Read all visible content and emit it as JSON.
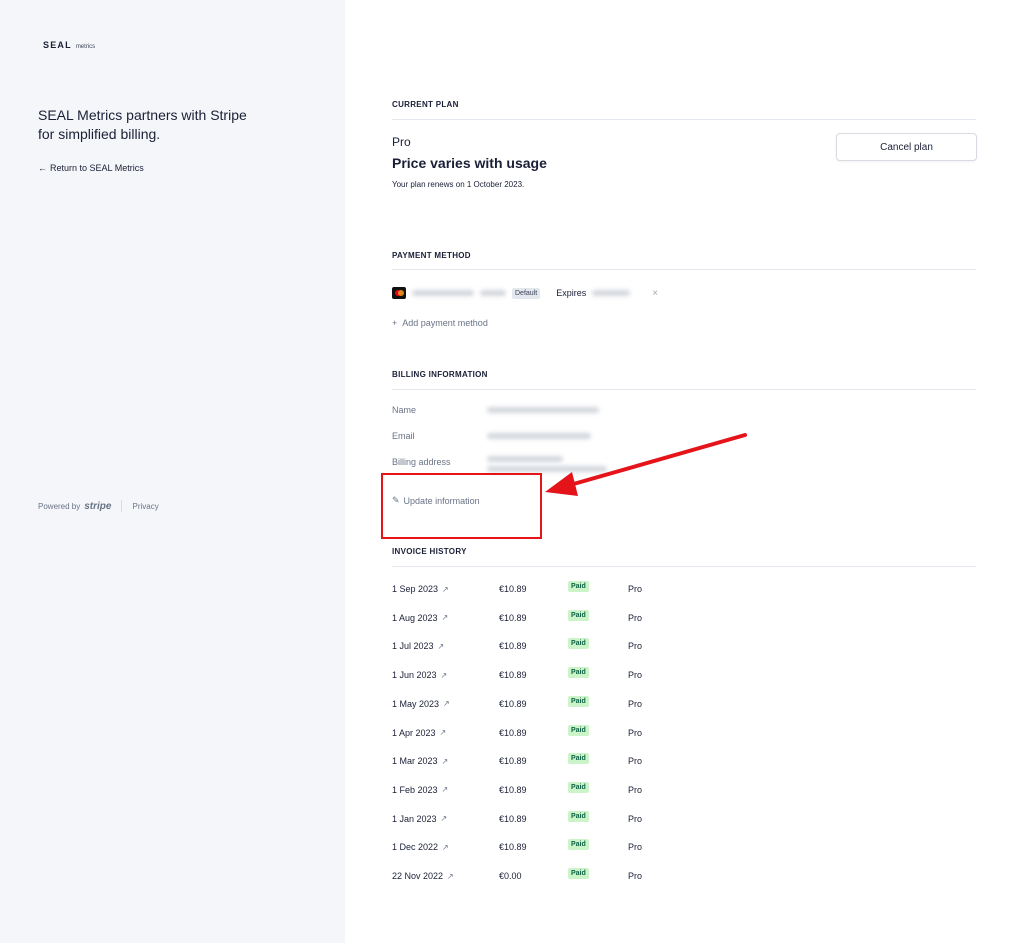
{
  "brand": {
    "logo_main": "SEAL",
    "logo_sub": "metrics"
  },
  "left": {
    "headline": "SEAL Metrics partners with Stripe for simplified billing.",
    "return_link": "Return to SEAL Metrics",
    "powered_by": "Powered by",
    "stripe": "stripe",
    "privacy": "Privacy"
  },
  "current_plan": {
    "section_title": "CURRENT PLAN",
    "name": "Pro",
    "price": "Price varies with usage",
    "renews": "Your plan renews on 1 October 2023.",
    "cancel_label": "Cancel plan"
  },
  "payment_method": {
    "section_title": "PAYMENT METHOD",
    "default_badge": "Default",
    "expires_label": "Expires",
    "remove_icon": "×",
    "add_label": "Add payment method"
  },
  "billing_info": {
    "section_title": "BILLING INFORMATION",
    "name_label": "Name",
    "email_label": "Email",
    "address_label": "Billing address",
    "update_label": "Update information"
  },
  "invoice_history": {
    "section_title": "INVOICE HISTORY",
    "rows": [
      {
        "date": "1 Sep 2023",
        "amount": "€10.89",
        "status": "Paid",
        "plan": "Pro"
      },
      {
        "date": "1 Aug 2023",
        "amount": "€10.89",
        "status": "Paid",
        "plan": "Pro"
      },
      {
        "date": "1 Jul 2023",
        "amount": "€10.89",
        "status": "Paid",
        "plan": "Pro"
      },
      {
        "date": "1 Jun 2023",
        "amount": "€10.89",
        "status": "Paid",
        "plan": "Pro"
      },
      {
        "date": "1 May 2023",
        "amount": "€10.89",
        "status": "Paid",
        "plan": "Pro"
      },
      {
        "date": "1 Apr 2023",
        "amount": "€10.89",
        "status": "Paid",
        "plan": "Pro"
      },
      {
        "date": "1 Mar 2023",
        "amount": "€10.89",
        "status": "Paid",
        "plan": "Pro"
      },
      {
        "date": "1 Feb 2023",
        "amount": "€10.89",
        "status": "Paid",
        "plan": "Pro"
      },
      {
        "date": "1 Jan 2023",
        "amount": "€10.89",
        "status": "Paid",
        "plan": "Pro"
      },
      {
        "date": "1 Dec 2022",
        "amount": "€10.89",
        "status": "Paid",
        "plan": "Pro"
      },
      {
        "date": "22 Nov 2022",
        "amount": "€0.00",
        "status": "Paid",
        "plan": "Pro"
      }
    ]
  },
  "colors": {
    "annotation": "#e5141b",
    "paid_bg": "#cbf4c9",
    "paid_text": "#0e6245",
    "left_bg": "#f5f6f9"
  },
  "icons": {
    "back": "arrow-left-icon",
    "plus": "plus-icon",
    "edit": "pencil-icon",
    "external": "external-link-icon",
    "card": "mastercard-icon"
  }
}
